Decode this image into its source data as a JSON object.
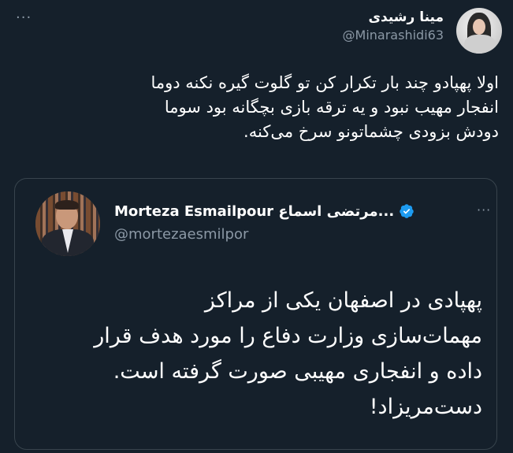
{
  "tweet": {
    "author_name": "مینا رشیدی",
    "author_handle": "@Minarashidi63",
    "more_label": "···",
    "lines": [
      "اولا پهپادو چند بار تکرار کن تو گلوت گیره نکنه دوما",
      "انفجار مهیب نبود و یه ترقه بازی بچگانه بود سوما",
      "دودش بزودی چشماتونو سرخ می‌کنه."
    ]
  },
  "quote": {
    "author_name": "Morteza Esmailpour مرتضی اسماع...",
    "author_handle": "@mortezaesmilpor",
    "more_label": "···",
    "lines": [
      "پهپادی در اصفهان یکی از مراکز",
      "مهمات‌سازی وزارت دفاع را مورد هدف قرار",
      "داده و انفجاری مهیبی صورت گرفته است.",
      "دست‌مریزاد!"
    ]
  },
  "icons": {
    "verified": "verified-badge-icon",
    "more": "more-options-icon"
  },
  "colors": {
    "background": "#15202b",
    "secondary_text": "#8b98a5",
    "border": "#38444d",
    "verified": "#1d9bf0"
  }
}
